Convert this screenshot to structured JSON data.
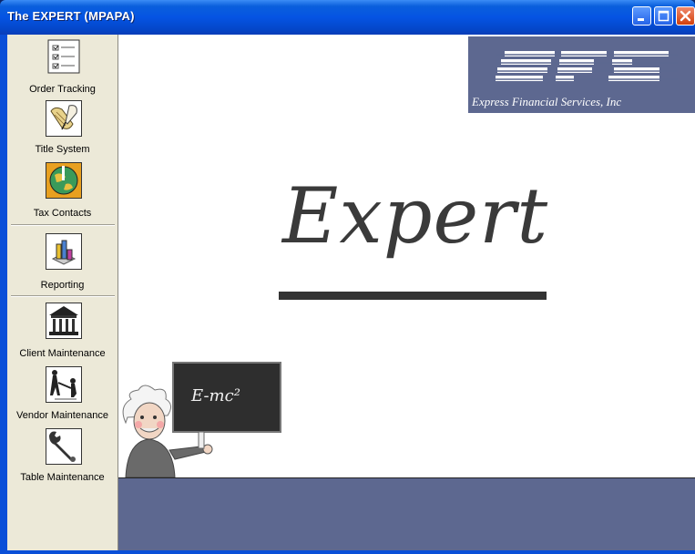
{
  "window": {
    "title": "The EXPERT (MPAPA)"
  },
  "sidebar": {
    "items": [
      {
        "label": "Order Tracking",
        "icon": "checklist-icon"
      },
      {
        "label": "Title System",
        "icon": "scroll-quill-icon"
      },
      {
        "label": "Tax Contacts",
        "icon": "globe-icon"
      },
      {
        "label": "Reporting",
        "icon": "bar-chart-icon"
      },
      {
        "label": "Client Maintenance",
        "icon": "bank-building-icon"
      },
      {
        "label": "Vendor Maintenance",
        "icon": "people-handshake-icon"
      },
      {
        "label": "Table Maintenance",
        "icon": "wrench-icon"
      }
    ]
  },
  "main": {
    "logo_text": "Express Financial Services, Inc",
    "splash_title": "Expert",
    "chalkboard_text": "E-mc²"
  },
  "colors": {
    "titlebar": "#0554e3",
    "sidebar_bg": "#ece9d8",
    "panel_slate": "#5d6890",
    "expert_text": "#3a3a3a"
  }
}
